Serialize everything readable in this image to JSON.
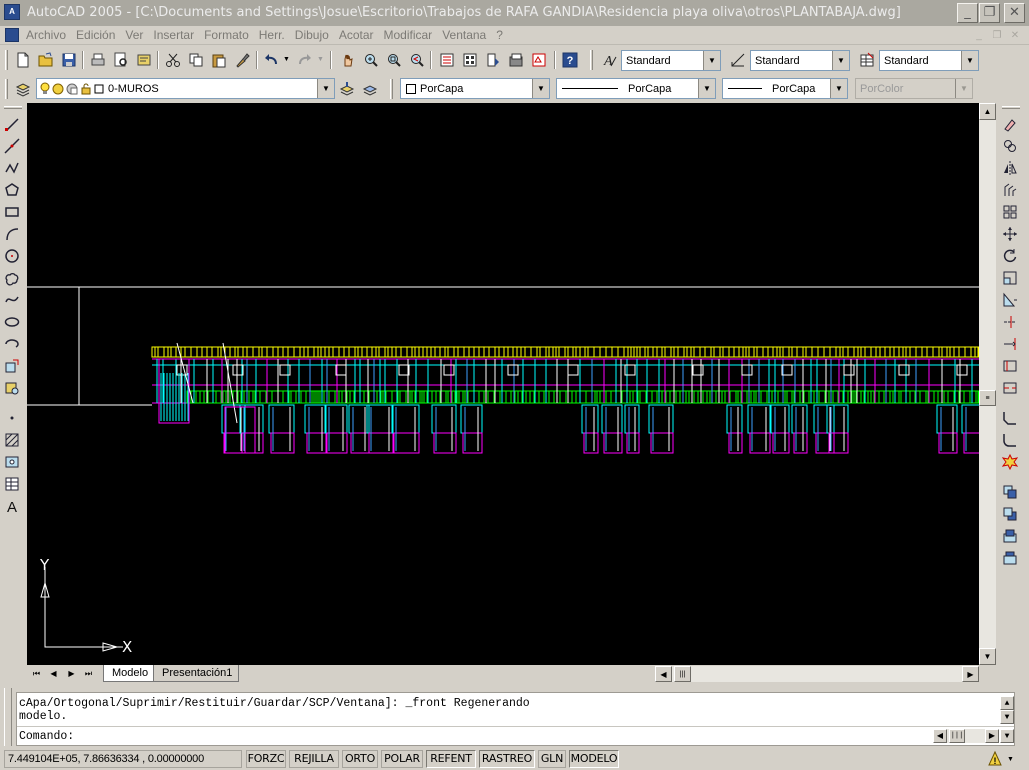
{
  "window": {
    "title": "AutoCAD 2005 - [C:\\Documents and Settings\\Josue\\Escritorio\\Trabajos de RAFA GANDIA\\Residencia playa oliva\\otros\\PLANTABAJA.dwg]",
    "buttons": {
      "minimize": "_",
      "restore": "❐",
      "close": "✕"
    }
  },
  "menu": {
    "items": [
      "Archivo",
      "Edición",
      "Ver",
      "Insertar",
      "Formato",
      "Herr.",
      "Dibujo",
      "Acotar",
      "Modificar",
      "Ventana",
      "?"
    ]
  },
  "styles_toolbar": {
    "text_style": "Standard",
    "dim_style": "Standard",
    "table_style": "Standard"
  },
  "layers_toolbar": {
    "current_layer": "0-MUROS",
    "color": "PorCapa",
    "linetype": "PorCapa",
    "lineweight": "PorCapa",
    "plot_style": "PorColor"
  },
  "drawing": {
    "ucs_y_label": "Y",
    "ucs_x_label": "X",
    "background": "#000000",
    "layer_colors": [
      "#ff00ff",
      "#00ffff",
      "#ffff00",
      "#00ff00",
      "#ffffff",
      "#3ea0ff"
    ]
  },
  "layout_tabs": {
    "items": [
      "Modelo",
      "Presentación1"
    ],
    "active": "Modelo"
  },
  "command": {
    "history_line1": "cApa/Ortogonal/Suprimir/Restituir/Guardar/SCP/Ventana]: _front Regenerando",
    "history_line2": "modelo.",
    "prompt": "Comando:"
  },
  "status": {
    "coordinates": "7.449104E+05, 7.86636334 , 0.00000000",
    "toggles": [
      "FORZC",
      "REJILLA",
      "ORTO",
      "POLAR",
      "REFENT",
      "RASTREO",
      "GLN",
      "MODELO"
    ],
    "active_toggles": [
      "REFENT",
      "RASTREO",
      "MODELO"
    ]
  },
  "icons": {
    "left_toolbar": [
      "line-icon",
      "construction-line-icon",
      "polyline-icon",
      "polygon-icon",
      "rectangle-icon",
      "arc-icon",
      "circle-icon",
      "revision-cloud-icon",
      "spline-icon",
      "ellipse-icon",
      "ellipse-arc-icon",
      "insert-block-icon",
      "make-block-icon",
      "point-icon",
      "hatch-icon",
      "region-icon",
      "table-icon",
      "multiline-text-icon"
    ],
    "right_toolbar": [
      "erase-icon",
      "copy-icon",
      "mirror-icon",
      "offset-icon",
      "array-icon",
      "move-icon",
      "rotate-icon",
      "scale-icon",
      "stretch-icon",
      "trim-icon",
      "extend-icon",
      "break-at-point-icon",
      "break-icon",
      "chamfer-icon",
      "fillet-icon",
      "explode-icon",
      "draworder-front-icon",
      "draworder-back-icon",
      "draworder-above-icon",
      "draworder-under-icon"
    ]
  }
}
